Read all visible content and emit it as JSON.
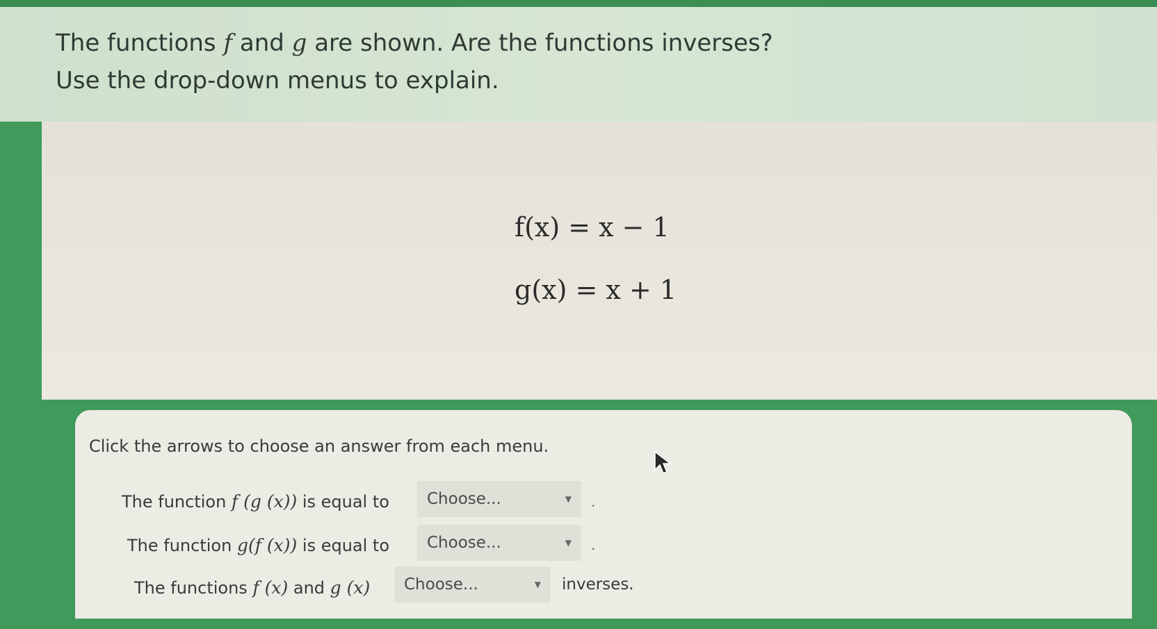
{
  "question": {
    "line1_before_f": "The functions ",
    "f_symbol": "f",
    "line1_between": " and ",
    "g_symbol": "g",
    "line1_after": " are shown. Are the functions inverses?",
    "line2": "Use the drop-down menus to explain."
  },
  "equations": {
    "f": "f(x) = x − 1",
    "g": "g(x) = x + 1"
  },
  "answer_panel": {
    "instruction": "Click the arrows to choose an answer from each menu.",
    "rows": [
      {
        "prefix": "The function ",
        "expr": "f (g (x))",
        "suffix": " is equal to",
        "select_value": "Choose...",
        "end": "."
      },
      {
        "prefix": "The function ",
        "expr": "g(f (x))",
        "suffix": " is equal to",
        "select_value": "Choose...",
        "end": "."
      },
      {
        "prefix": "The functions ",
        "expr1": "f (x)",
        "middle": " and ",
        "expr2": "g (x)",
        "select_value": "Choose...",
        "end": "inverses."
      }
    ]
  },
  "icons": {
    "dropdown_caret": "caret-down-icon",
    "cursor": "mouse-pointer-icon"
  },
  "colors": {
    "green_background": "#3f9a5c",
    "header_band": "#d3e4d1",
    "panel": "#ecebe4"
  }
}
